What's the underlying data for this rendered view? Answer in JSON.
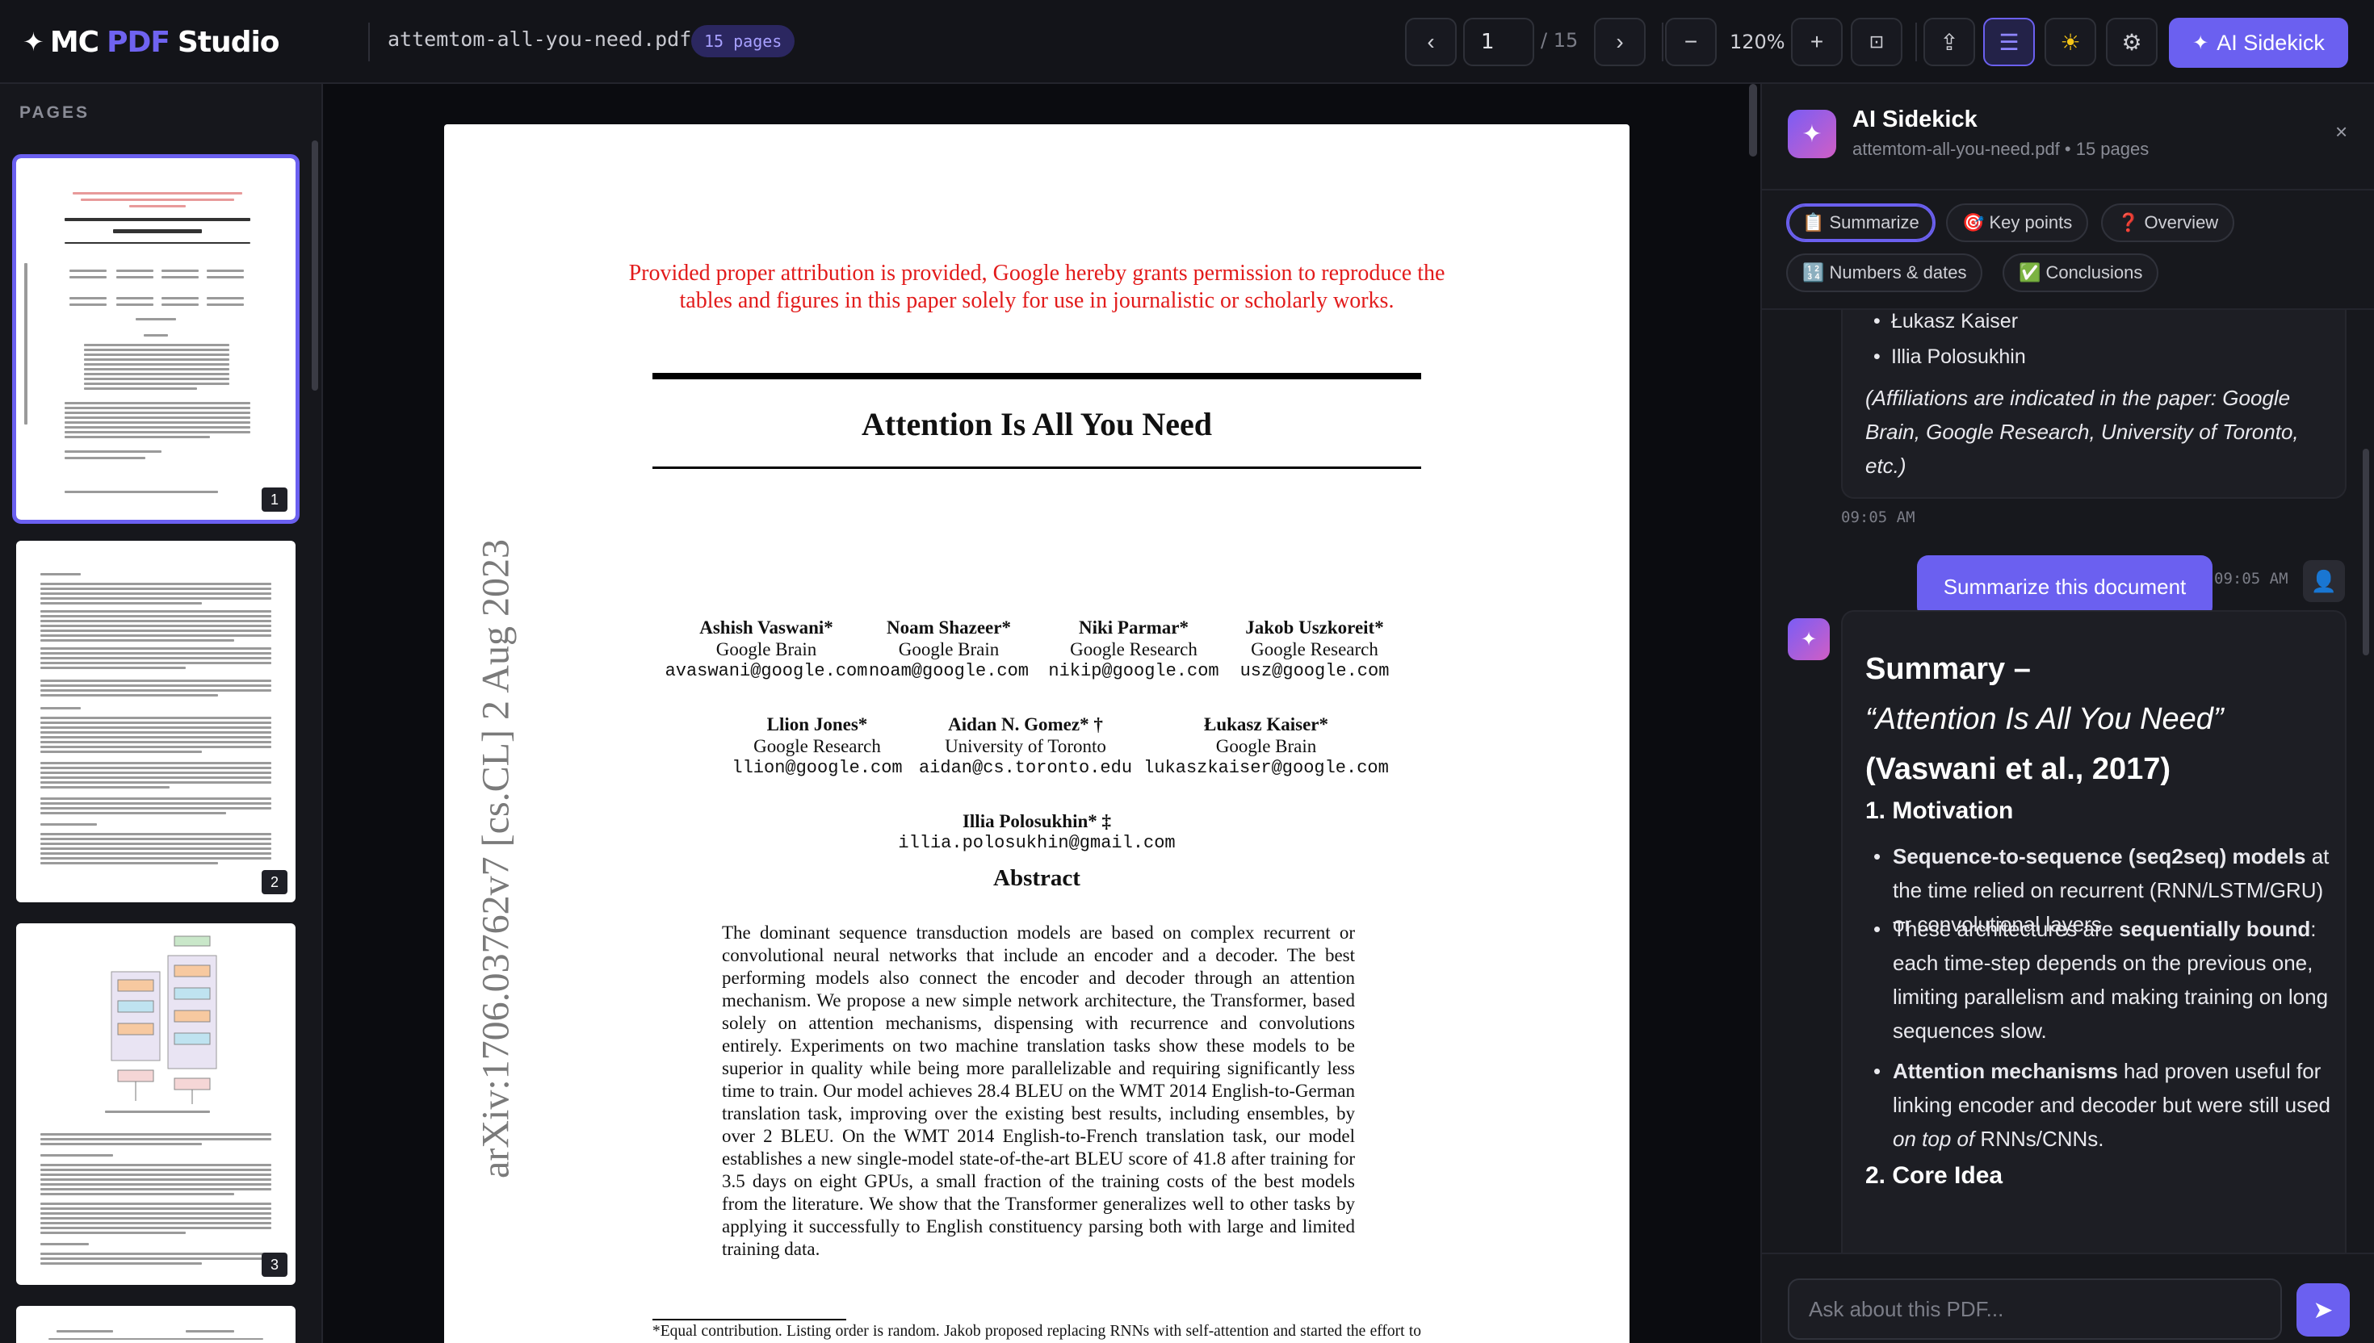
{
  "app": {
    "brand_prefix": "MC",
    "brand_accent": "PDF",
    "brand_suffix": "Studio",
    "file_name": "attemtom-all-you-need.pdf",
    "page_count_badge": "15 pages",
    "accent_color": "#6b60f0"
  },
  "toolbar": {
    "prev_icon": "‹",
    "page_value": "1",
    "page_total": "/ 15",
    "next_icon": "›",
    "zoom_out": "−",
    "zoom_level": "120%",
    "zoom_in": "+",
    "fit_icon": "⊡",
    "export_icon": "⇪",
    "outline_icon": "☰",
    "theme_icon": "☀",
    "settings_icon": "⚙",
    "ai_button_label": "AI Sidekick"
  },
  "sidebar": {
    "title": "PAGES",
    "thumbnails": [
      {
        "num": "1"
      },
      {
        "num": "2"
      },
      {
        "num": "3"
      }
    ]
  },
  "document": {
    "attribution": "Provided proper attribution is provided, Google hereby grants permission to reproduce the tables and figures in this paper solely for use in journalistic or scholarly works.",
    "title": "Attention Is All You Need",
    "arxiv_id": "arXiv:1706.03762v7 [cs.CL] 2 Aug 2023",
    "authors": [
      {
        "name": "Ashish Vaswani*",
        "affil": "Google Brain",
        "email": "avaswani@google.com"
      },
      {
        "name": "Noam Shazeer*",
        "affil": "Google Brain",
        "email": "noam@google.com"
      },
      {
        "name": "Niki Parmar*",
        "affil": "Google Research",
        "email": "nikip@google.com"
      },
      {
        "name": "Jakob Uszkoreit*",
        "affil": "Google Research",
        "email": "usz@google.com"
      },
      {
        "name": "Llion Jones*",
        "affil": "Google Research",
        "email": "llion@google.com"
      },
      {
        "name": "Aidan N. Gomez* †",
        "affil": "University of Toronto",
        "email": "aidan@cs.toronto.edu"
      },
      {
        "name": "Łukasz Kaiser*",
        "affil": "Google Brain",
        "email": "lukaszkaiser@google.com"
      },
      {
        "name": "Illia Polosukhin* ‡",
        "affil": "",
        "email": "illia.polosukhin@gmail.com"
      }
    ],
    "abstract_title": "Abstract",
    "abstract": "The dominant sequence transduction models are based on complex recurrent or convolutional neural networks that include an encoder and a decoder. The best performing models also connect the encoder and decoder through an attention mechanism. We propose a new simple network architecture, the Transformer, based solely on attention mechanisms, dispensing with recurrence and convolutions entirely. Experiments on two machine translation tasks show these models to be superior in quality while being more parallelizable and requiring significantly less time to train. Our model achieves 28.4 BLEU on the WMT 2014 English-to-German translation task, improving over the existing best results, including ensembles, by over 2 BLEU. On the WMT 2014 English-to-French translation task, our model establishes a new single-model state-of-the-art BLEU score of 41.8 after training for 3.5 days on eight GPUs, a small fraction of the training costs of the best models from the literature. We show that the Transformer generalizes well to other tasks by applying it successfully to English constituency parsing both with large and limited training data.",
    "footnote": "*Equal contribution. Listing order is random. Jakob proposed replacing RNNs with self-attention and started the effort to evaluate this idea. Ashish, with Illia, designed and implemented the first Transformer models and has been crucially involved in every aspect of this work. Noam proposed scaled dot-product attention, multi-head"
  },
  "panel": {
    "title": "AI Sidekick",
    "subtitle": "attemtom-all-you-need.pdf • 15 pages",
    "close_icon": "×",
    "chips": [
      {
        "label": "📋 Summarize"
      },
      {
        "label": "🎯 Key points"
      },
      {
        "label": "❓ Overview"
      },
      {
        "label": "🔢 Numbers & dates"
      },
      {
        "label": "✅ Conclusions"
      }
    ],
    "prev_message": {
      "items": [
        "Łukasz Kaiser",
        "Illia Polosukhin"
      ],
      "note": "(Affiliations are indicated in the paper: Google Brain, Google Research, University of Toronto, etc.)",
      "time": "09:05 AM"
    },
    "user_message": {
      "text": "Summarize this document",
      "time": "09:05 AM"
    },
    "summary": {
      "title_line1": "Summary –",
      "title_line2": "“Attention Is All You Need”",
      "title_line3": "(Vaswani et al., 2017)",
      "section1": "1. Motivation",
      "b1_bold": "Sequence-to-sequence (seq2seq) models",
      "b1_rest": " at the time relied on recurrent (RNN/LSTM/GRU) or convolutional layers.",
      "b2_pre": "These architectures are ",
      "b2_bold": "sequentially bound",
      "b2_rest": ": each time-step depends on the previous one, limiting parallelism and making training on long sequences slow.",
      "b3_bold": "Attention mechanisms",
      "b3_mid": " had proven useful for linking encoder and decoder but were still used ",
      "b3_ital": "on top of",
      "b3_rest": " RNNs/CNNs.",
      "section2": "2. Core Idea"
    },
    "input_placeholder": "Ask about this PDF...",
    "send_icon": "➤"
  }
}
